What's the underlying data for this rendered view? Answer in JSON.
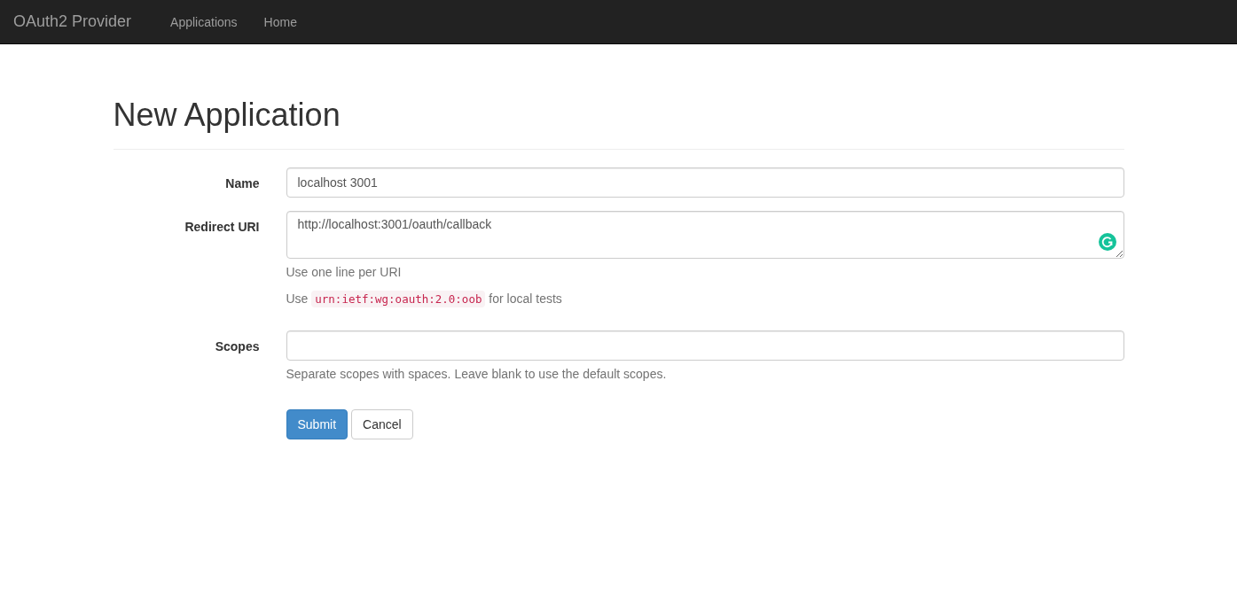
{
  "navbar": {
    "brand": "OAuth2 Provider",
    "links": [
      "Applications",
      "Home"
    ]
  },
  "page": {
    "title": "New Application"
  },
  "form": {
    "fields": [
      {
        "kind": "input",
        "label": "Name",
        "value": "localhost 3001"
      },
      {
        "kind": "textarea",
        "label": "Redirect URI",
        "value": "http://localhost:3001/oauth/callback",
        "help": [
          {
            "text": "Use one line per URI"
          },
          {
            "before": "Use",
            "code": "urn:ietf:wg:oauth:2.0:oob",
            "after": "for local tests"
          }
        ]
      },
      {
        "kind": "input",
        "label": "Scopes",
        "help": [
          {
            "text": "Separate scopes with spaces. Leave blank to use the default scopes."
          }
        ]
      }
    ],
    "buttons": [
      {
        "kind": "primary",
        "label": "Submit"
      },
      {
        "kind": "default",
        "label": "Cancel"
      }
    ]
  }
}
